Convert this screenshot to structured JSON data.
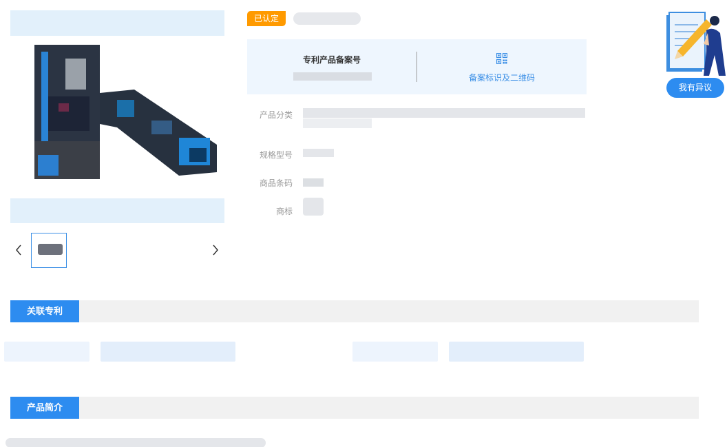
{
  "product": {
    "badge": "已认定"
  },
  "record": {
    "title": "专利产品备案号",
    "qr_link": "备案标识及二维码"
  },
  "attributes": {
    "category_label": "产品分类",
    "model_label": "规格型号",
    "barcode_label": "商品条码",
    "trademark_label": "商标"
  },
  "objection": {
    "button_label": "我有异议"
  },
  "sections": {
    "patents": "关联专利",
    "intro": "产品简介"
  },
  "gallery": {
    "prev_icon": "chevron-left-icon",
    "next_icon": "chevron-right-icon"
  },
  "colors": {
    "accent": "#2d8cf0",
    "badge": "#ff9a00",
    "panel": "#eef6fe"
  }
}
